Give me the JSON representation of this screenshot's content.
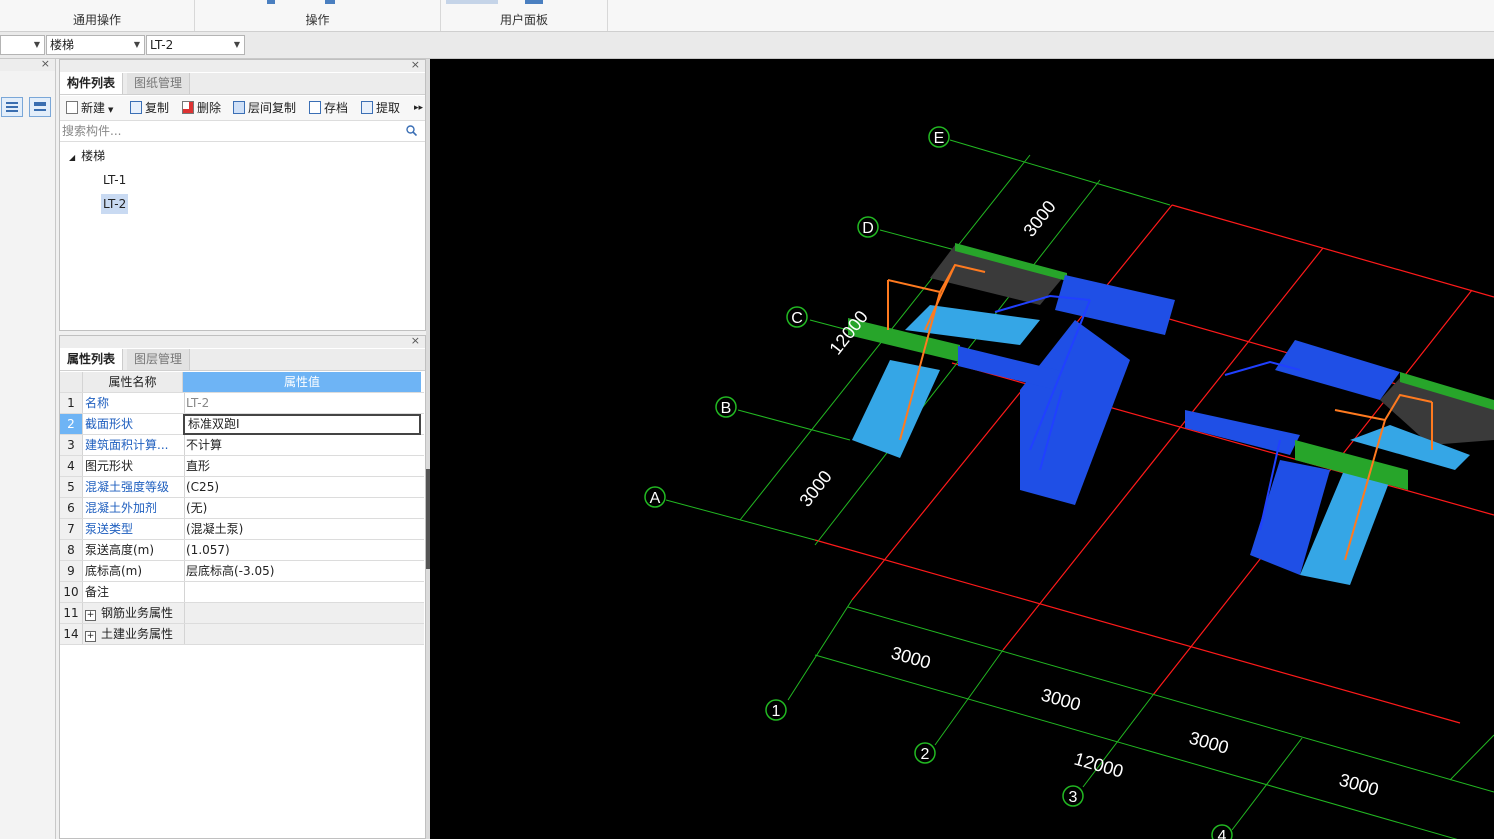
{
  "ribbon": {
    "groups": [
      "通用操作",
      "操作",
      "用户面板"
    ]
  },
  "selectors": {
    "category": "",
    "component_type": "楼梯",
    "component": "LT-2"
  },
  "component_panel": {
    "tabs": [
      "构件列表",
      "图纸管理"
    ],
    "toolbar": {
      "new": "新建",
      "copy": "复制",
      "delete": "删除",
      "floor_copy": "层间复制",
      "save": "存档",
      "extract": "提取"
    },
    "search_placeholder": "搜索构件...",
    "tree": {
      "root": "楼梯",
      "items": [
        "LT-1",
        "LT-2"
      ],
      "selected": "LT-2"
    }
  },
  "property_panel": {
    "tabs": [
      "属性列表",
      "图层管理"
    ],
    "columns": [
      "属性名称",
      "属性值"
    ],
    "rows": [
      {
        "num": "1",
        "name": "名称",
        "value": "LT-2"
      },
      {
        "num": "2",
        "name": "截面形状",
        "value": "标准双跑I"
      },
      {
        "num": "3",
        "name": "建筑面积计算...",
        "value": "不计算"
      },
      {
        "num": "4",
        "name": "图元形状",
        "value": "直形"
      },
      {
        "num": "5",
        "name": "混凝土强度等级",
        "value": "(C25)"
      },
      {
        "num": "6",
        "name": "混凝土外加剂",
        "value": "(无)"
      },
      {
        "num": "7",
        "name": "泵送类型",
        "value": "(混凝土泵)"
      },
      {
        "num": "8",
        "name": "泵送高度(m)",
        "value": "(1.057)"
      },
      {
        "num": "9",
        "name": "底标高(m)",
        "value": "层底标高(-3.05)"
      },
      {
        "num": "10",
        "name": "备注",
        "value": ""
      },
      {
        "num": "11",
        "name": "钢筋业务属性",
        "value": ""
      },
      {
        "num": "14",
        "name": "土建业务属性",
        "value": ""
      }
    ]
  },
  "viewport": {
    "axis_letters": [
      "A",
      "B",
      "C",
      "D",
      "E"
    ],
    "axis_numbers": [
      "1",
      "2",
      "3",
      "4"
    ],
    "dimensions": {
      "d_3000_top": "3000",
      "d_12000_left": "12000",
      "d_3000_left": "3000",
      "d_3000_b1": "3000",
      "d_3000_b2": "3000",
      "d_3000_b3": "3000",
      "d_3000_b4": "3000",
      "d_12000_bottom": "12000"
    },
    "colors": {
      "background": "#000000",
      "axis_grid": "#ff1a1a",
      "dimension": "#22b822",
      "stair_blue": "#1f4fe6",
      "stair_cyan": "#35a6e6",
      "beam_green": "#27a52a",
      "railing": "#ff7a1f",
      "slab": "#3a3a3a"
    }
  }
}
